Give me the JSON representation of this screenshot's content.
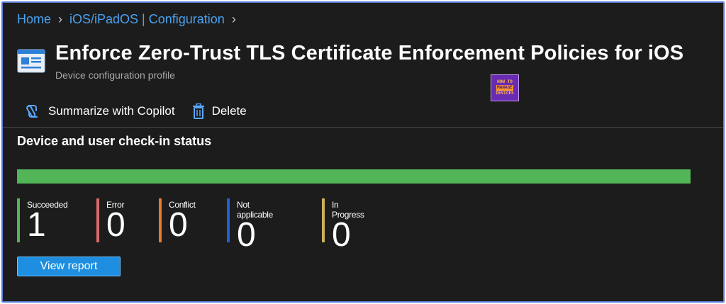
{
  "breadcrumb": {
    "home": "Home",
    "section": "iOS/iPadOS | Configuration"
  },
  "header": {
    "title": "Enforce Zero-Trust TLS Certificate Enforcement Policies for iOS",
    "subtitle": "Device configuration profile",
    "icon": "profile-window-icon"
  },
  "watermark": {
    "line1": "HOW TO",
    "line2": "MANAGE",
    "line3": "DEVICES"
  },
  "toolbar": {
    "copilot_label": "Summarize with Copilot",
    "copilot_icon": "copilot-icon",
    "delete_label": "Delete",
    "delete_icon": "trash-icon"
  },
  "checkin": {
    "title": "Device and user check-in status",
    "progress_succeeded_fraction": 1.0,
    "stats": [
      {
        "label": "Succeeded",
        "value": "1",
        "color": "#52b558"
      },
      {
        "label": "Error",
        "value": "0",
        "color": "#d86a6a"
      },
      {
        "label": "Conflict",
        "value": "0",
        "color": "#e8792f"
      },
      {
        "label": "Not applicable",
        "value": "0",
        "color": "#1e5fd6"
      },
      {
        "label": "In Progress",
        "value": "0",
        "color": "#c9b35a"
      }
    ],
    "view_report_label": "View report"
  },
  "colors": {
    "accent": "#1e8fe0",
    "link": "#4aa3f0",
    "background": "#1c1c1c",
    "success": "#52b558"
  }
}
